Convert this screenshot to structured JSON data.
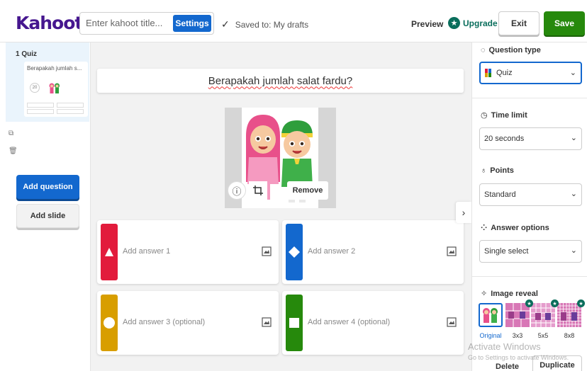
{
  "header": {
    "logo": "Kahoot!",
    "title_placeholder": "Enter kahoot title...",
    "settings_label": "Settings",
    "saved_label": "Saved to: My drafts",
    "preview_label": "Preview",
    "upgrade_label": "Upgrade",
    "exit_label": "Exit",
    "save_label": "Save"
  },
  "sidebar": {
    "slide_label": "1  Quiz",
    "thumb_title": "Berapakah jumlah s...",
    "thumb_timer": "20",
    "add_question_label": "Add question",
    "add_slide_label": "Add slide"
  },
  "question": {
    "text": "Berapakah jumlah salat fardu?",
    "remove_label": "Remove"
  },
  "answers": [
    {
      "placeholder": "Add answer 1",
      "color": "#e21b3c",
      "shape": "triangle"
    },
    {
      "placeholder": "Add answer 2",
      "color": "#1368ce",
      "shape": "diamond"
    },
    {
      "placeholder": "Add answer 3 (optional)",
      "color": "#d89e00",
      "shape": "circle"
    },
    {
      "placeholder": "Add answer 4 (optional)",
      "color": "#26890c",
      "shape": "square"
    }
  ],
  "panel": {
    "question_type": {
      "label": "Question type",
      "value": "Quiz"
    },
    "time_limit": {
      "label": "Time limit",
      "value": "20 seconds"
    },
    "points": {
      "label": "Points",
      "value": "Standard"
    },
    "answer_options": {
      "label": "Answer options",
      "value": "Single select"
    },
    "image_reveal": {
      "label": "Image reveal",
      "options": [
        "Original",
        "3x3",
        "5x5",
        "8x8"
      ],
      "selected": "Original"
    },
    "delete_label": "Delete",
    "duplicate_label": "Duplicate"
  },
  "watermark": {
    "line1": "Activate Windows",
    "line2": "Go to Settings to activate Windows."
  },
  "colors": {
    "brand": "#46178f",
    "primary": "#1368ce",
    "save": "#26890c",
    "upgrade": "#0a6e5c"
  }
}
